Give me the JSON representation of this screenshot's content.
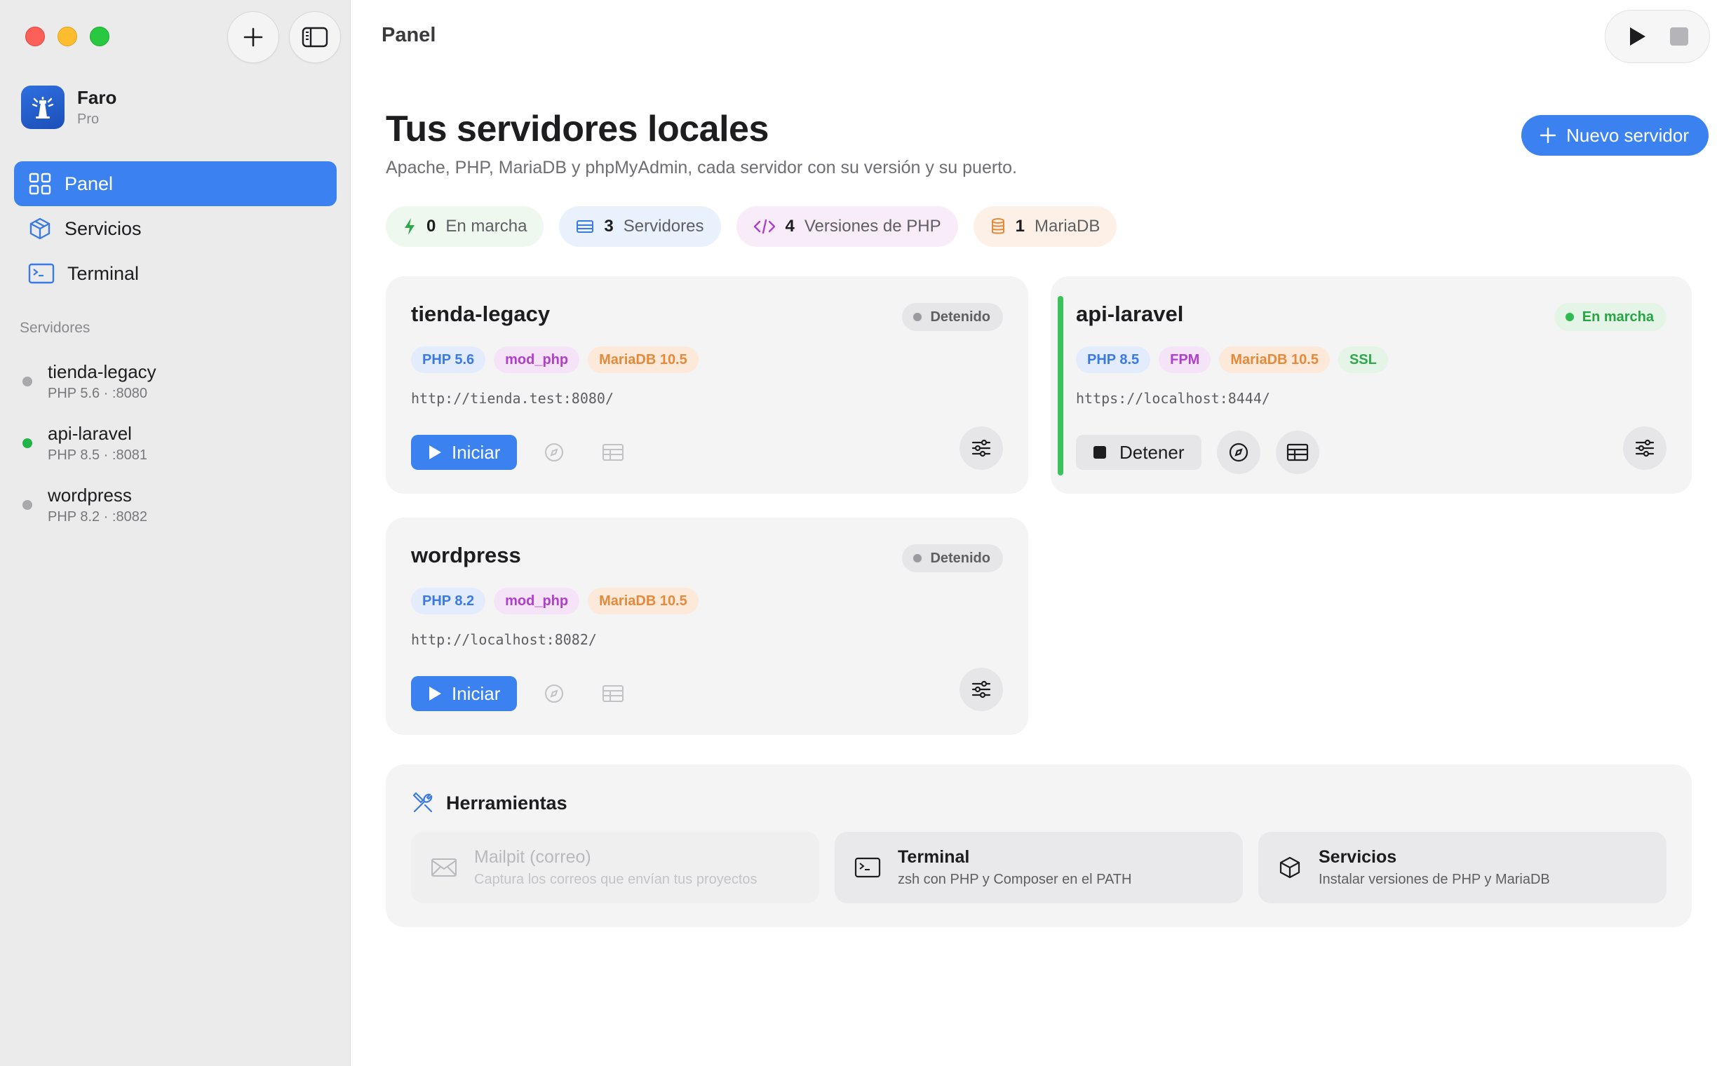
{
  "app": {
    "name": "Faro",
    "tier": "Pro"
  },
  "nav": [
    {
      "label": "Panel",
      "icon": "grid-icon",
      "active": true
    },
    {
      "label": "Servicios",
      "icon": "cube-icon",
      "active": false
    },
    {
      "label": "Terminal",
      "icon": "terminal-icon",
      "active": false
    }
  ],
  "sidebar_section": "Servidores",
  "sidebar_servers": [
    {
      "name": "tienda-legacy",
      "sub": "PHP 5.6 · :8080",
      "running": false
    },
    {
      "name": "api-laravel",
      "sub": "PHP 8.5 · :8081",
      "running": true
    },
    {
      "name": "wordpress",
      "sub": "PHP 8.2 · :8082",
      "running": false
    }
  ],
  "topbar": {
    "title": "Panel"
  },
  "page": {
    "title": "Tus servidores locales",
    "subtitle": "Apache, PHP, MariaDB y phpMyAdmin, cada servidor con su versión y su puerto.",
    "new_button": "Nuevo servidor"
  },
  "stats": [
    {
      "count": "0",
      "label": "En marcha",
      "color": "#2fa84c"
    },
    {
      "count": "3",
      "label": "Servidores",
      "color": "#3b7ae6"
    },
    {
      "count": "4",
      "label": "Versiones de PHP",
      "color": "#b03fcc"
    },
    {
      "count": "1",
      "label": "MariaDB",
      "color": "#e58a3a"
    }
  ],
  "cards": [
    {
      "name": "tienda-legacy",
      "status": "Detenido",
      "running": false,
      "tags": [
        "PHP 5.6",
        "mod_php",
        "MariaDB 10.5"
      ],
      "url": "http://tienda.test:8080/",
      "action": "Iniciar"
    },
    {
      "name": "api-laravel",
      "status": "En marcha",
      "running": true,
      "tags": [
        "PHP 8.5",
        "FPM",
        "MariaDB 10.5",
        "SSL"
      ],
      "url": "https://localhost:8444/",
      "action": "Detener"
    },
    {
      "name": "wordpress",
      "status": "Detenido",
      "running": false,
      "tags": [
        "PHP 8.2",
        "mod_php",
        "MariaDB 10.5"
      ],
      "url": "http://localhost:8082/",
      "action": "Iniciar"
    }
  ],
  "tools": {
    "title": "Herramientas",
    "items": [
      {
        "name": "Mailpit (correo)",
        "desc": "Captura los correos que envían tus proyectos",
        "icon": "envelope-icon",
        "enabled": false
      },
      {
        "name": "Terminal",
        "desc": "zsh con PHP y Composer en el PATH",
        "icon": "terminal-icon",
        "enabled": true
      },
      {
        "name": "Servicios",
        "desc": "Instalar versiones de PHP y MariaDB",
        "icon": "cube-icon",
        "enabled": true
      }
    ]
  },
  "colors": {
    "accent": "#3b82f0",
    "running": "#2fbb4f",
    "stopped": "#9a9aa0"
  }
}
